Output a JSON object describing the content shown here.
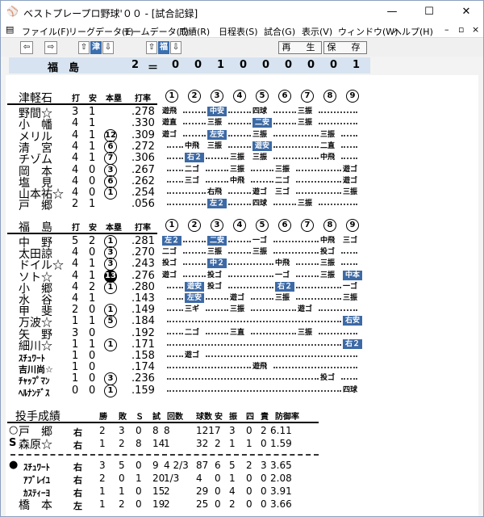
{
  "window": {
    "title": "ベストプレープロ野球'００ - [試合記録]",
    "min": "—",
    "max": "☐",
    "close": "✕"
  },
  "menu": [
    "ファイル(F)",
    "リーグデータ(L)",
    "チームデータ(T)",
    "成績(R)",
    "日程表(S)",
    "試合(G)",
    "表示(V)",
    "ウィンドウ(W)",
    "ヘルプ(H)"
  ],
  "toolbar": {
    "team1": "津",
    "team2": "福",
    "replay": "再　生",
    "save": "保　存"
  },
  "scoreboard": {
    "team": "福　島",
    "runs": "2",
    "eq": "＝",
    "innings": [
      "0",
      "0",
      "1",
      "0",
      "0",
      "0",
      "0",
      "0",
      "1"
    ]
  },
  "tsugaru": {
    "name": "津軽石",
    "cols": {
      "ab": "打",
      "h": "安",
      "hr": "本塁",
      "avg": "打率"
    },
    "innings": [
      "1",
      "2",
      "3",
      "4",
      "5",
      "6",
      "7",
      "8",
      "9"
    ],
    "players": [
      {
        "name": "野間☆",
        "ab": "3",
        "h": "1",
        "hr": "",
        "avg": ".278"
      },
      {
        "name": "小　幡",
        "ab": "4",
        "h": "1",
        "hr": "",
        "avg": ".330"
      },
      {
        "name": "メリル",
        "ab": "4",
        "h": "1",
        "hr": "12",
        "avg": ".309"
      },
      {
        "name": "清　宮",
        "ab": "4",
        "h": "1",
        "hr": "6",
        "avg": ".272"
      },
      {
        "name": "チゾム",
        "ab": "4",
        "h": "1",
        "hr": "7",
        "avg": ".306"
      },
      {
        "name": "岡　本",
        "ab": "4",
        "h": "0",
        "hr": "3",
        "avg": ".267"
      },
      {
        "name": "塩　見",
        "ab": "4",
        "h": "0",
        "hr": "6",
        "avg": ".262"
      },
      {
        "name": "山本祐☆",
        "ab": "4",
        "h": "0",
        "hr": "1",
        "avg": ".254"
      },
      {
        "name": "戸　郷",
        "ab": "2",
        "h": "1",
        "hr": "",
        "avg": ".056"
      }
    ],
    "events": [
      [
        [
          "遊飛",
          0,
          ""
        ],
        [
          "中安",
          2,
          "hit"
        ],
        [
          "四球",
          4,
          ""
        ],
        [
          "三振",
          6,
          ""
        ]
      ],
      [
        [
          "遊直",
          0,
          ""
        ],
        [
          "三振",
          2,
          ""
        ],
        [
          "二安",
          4,
          "hit"
        ],
        [
          "三振",
          6,
          ""
        ]
      ],
      [
        [
          "遊ゴ",
          0,
          ""
        ],
        [
          "左安",
          2,
          "hit"
        ],
        [
          "三振",
          4,
          ""
        ],
        [
          "三振",
          7,
          ""
        ]
      ],
      [
        [
          "中飛",
          1,
          ""
        ],
        [
          "三振",
          2,
          ""
        ],
        [
          "遊安",
          4,
          "hit"
        ],
        [
          "二直",
          7,
          ""
        ]
      ],
      [
        [
          "右２",
          1,
          "hit"
        ],
        [
          "三振",
          3,
          ""
        ],
        [
          "三振",
          4,
          ""
        ],
        [
          "中飛",
          7,
          ""
        ]
      ],
      [
        [
          "二ゴ",
          1,
          ""
        ],
        [
          "三振",
          3,
          ""
        ],
        [
          "三振",
          5,
          ""
        ],
        [
          "遊ゴ",
          8,
          ""
        ]
      ],
      [
        [
          "三ゴ",
          1,
          ""
        ],
        [
          "中飛",
          3,
          ""
        ],
        [
          "二ゴ",
          5,
          ""
        ],
        [
          "遊ゴ",
          8,
          ""
        ]
      ],
      [
        [
          "右飛",
          2,
          ""
        ],
        [
          "遊ゴ",
          4,
          ""
        ],
        [
          "三ゴ",
          5,
          ""
        ],
        [
          "三振",
          8,
          ""
        ]
      ],
      [
        [
          "左２",
          2,
          "hit"
        ],
        [
          "四球",
          4,
          ""
        ],
        [
          "三振",
          6,
          ""
        ]
      ]
    ]
  },
  "fukushima": {
    "name": "福　島",
    "cols": {
      "ab": "打",
      "h": "安",
      "hr": "本塁",
      "avg": "打率"
    },
    "innings": [
      "1",
      "2",
      "3",
      "4",
      "5",
      "6",
      "7",
      "8",
      "9"
    ],
    "players": [
      {
        "name": "中　野",
        "ab": "5",
        "h": "2",
        "hr": "1",
        "avg": ".281",
        "sm": false
      },
      {
        "name": "太田諒",
        "ab": "4",
        "h": "0",
        "hr": "3",
        "avg": ".270",
        "sm": false
      },
      {
        "name": "ドイル☆",
        "ab": "4",
        "h": "1",
        "hr": "3",
        "avg": ".243",
        "sm": false
      },
      {
        "name": "ソト☆",
        "ab": "4",
        "h": "1",
        "hr": "13",
        "avg": ".276",
        "sm": false
      },
      {
        "name": "小　郷",
        "ab": "4",
        "h": "2",
        "hr": "1",
        "avg": ".280",
        "sm": false
      },
      {
        "name": "水　谷",
        "ab": "4",
        "h": "1",
        "hr": "",
        "avg": ".143",
        "sm": false
      },
      {
        "name": "甲　斐",
        "ab": "2",
        "h": "0",
        "hr": "1",
        "avg": ".149",
        "sm": false
      },
      {
        "name": "万波☆",
        "ab": "1",
        "h": "1",
        "hr": "5",
        "avg": ".184",
        "sm": false
      },
      {
        "name": "矢　野",
        "ab": "3",
        "h": "0",
        "hr": "",
        "avg": ".192",
        "sm": false
      },
      {
        "name": "細川☆",
        "ab": "1",
        "h": "1",
        "hr": "1",
        "avg": ".171",
        "sm": false
      },
      {
        "name": "ｽﾁｭﾜｰﾄ",
        "ab": "1",
        "h": "0",
        "hr": "",
        "avg": ".158",
        "sm": true
      },
      {
        "name": "吉川尚☆",
        "ab": "1",
        "h": "0",
        "hr": "",
        "avg": ".174",
        "sm": true
      },
      {
        "name": "ﾁｬｯﾌﾟﾏﾝ",
        "ab": "1",
        "h": "0",
        "hr": "3",
        "avg": ".236",
        "sm": true
      },
      {
        "name": "ﾍﾙﾅﾝﾃﾞｽ",
        "ab": "0",
        "h": "0",
        "hr": "1",
        "avg": ".159",
        "sm": true
      }
    ],
    "events": [
      [
        [
          "左２",
          0,
          "hit"
        ],
        [
          "二安",
          2,
          "hit"
        ],
        [
          "一ゴ",
          4,
          ""
        ],
        [
          "中飛",
          7,
          ""
        ],
        [
          "三ゴ",
          8,
          ""
        ]
      ],
      [
        [
          "二ゴ",
          0,
          ""
        ],
        [
          "三振",
          2,
          ""
        ],
        [
          "三振",
          4,
          ""
        ],
        [
          "投ゴ",
          7,
          ""
        ]
      ],
      [
        [
          "投ゴ",
          0,
          ""
        ],
        [
          "中２",
          2,
          "hit"
        ],
        [
          "中飛",
          5,
          ""
        ],
        [
          "三振",
          7,
          ""
        ]
      ],
      [
        [
          "遊ゴ",
          0,
          ""
        ],
        [
          "投ゴ",
          2,
          ""
        ],
        [
          "一ゴ",
          5,
          ""
        ],
        [
          "三振",
          7,
          ""
        ],
        [
          "中本",
          8,
          "hit"
        ]
      ],
      [
        [
          "遊安",
          1,
          "hit"
        ],
        [
          "投ゴ",
          2,
          ""
        ],
        [
          "右２",
          5,
          "hit"
        ],
        [
          "一ゴ",
          8,
          ""
        ]
      ],
      [
        [
          "左安",
          1,
          "hit"
        ],
        [
          "遊ゴ",
          3,
          ""
        ],
        [
          "三振",
          5,
          ""
        ],
        [
          "三振",
          8,
          ""
        ]
      ],
      [
        [
          "三ギ",
          1,
          ""
        ],
        [
          "三振",
          3,
          ""
        ],
        [
          "遊ゴ",
          6,
          ""
        ]
      ],
      [
        [
          "右安",
          8,
          "hit"
        ]
      ],
      [
        [
          "二ゴ",
          1,
          ""
        ],
        [
          "三直",
          3,
          ""
        ],
        [
          "三振",
          6,
          ""
        ]
      ],
      [
        [
          "右２",
          8,
          "hit"
        ]
      ],
      [
        [
          "遊ゴ",
          1,
          ""
        ]
      ],
      [
        [
          "遊飛",
          4,
          ""
        ]
      ],
      [
        [
          "投ゴ",
          7,
          ""
        ]
      ],
      [
        [
          "四球",
          8,
          ""
        ]
      ]
    ]
  },
  "pitching": {
    "title": "投手成績",
    "cols": [
      "勝",
      "敗",
      "Ｓ",
      "試",
      "回数",
      "球数",
      "安",
      "振",
      "四",
      "責",
      "防御率"
    ],
    "rows": [
      {
        "mark": "○",
        "name": "戸　郷",
        "hand": "右",
        "w": "2",
        "l": "3",
        "s": "0",
        "g": "8",
        "ip": "8",
        "np": "121",
        "h": "7",
        "k": "3",
        "bb": "0",
        "er": "2",
        "era": "6.11",
        "sm": false
      },
      {
        "mark": "S",
        "name": "森原☆",
        "hand": "右",
        "w": "1",
        "l": "2",
        "s": "8",
        "g": "14",
        "ip": "1",
        "np": "32",
        "h": "2",
        "k": "1",
        "bb": "1",
        "er": "0",
        "era": "1.59",
        "sm": false
      },
      {
        "mark": "●",
        "name": "ｽﾁｭﾜｰﾄ",
        "hand": "右",
        "w": "3",
        "l": "5",
        "s": "0",
        "g": "9",
        "ip": "4 2/3",
        "np": "87",
        "h": "6",
        "k": "5",
        "bb": "2",
        "er": "3",
        "era": "3.65",
        "sm": true
      },
      {
        "mark": "",
        "name": "ｱﾌﾞﾚｲﾕ",
        "hand": "右",
        "w": "2",
        "l": "0",
        "s": "1",
        "g": "20",
        "ip": "1/3",
        "np": "4",
        "h": "0",
        "k": "1",
        "bb": "0",
        "er": "0",
        "era": "2.08",
        "sm": true
      },
      {
        "mark": "",
        "name": "ｶｽﾃｨｰﾖ",
        "hand": "右",
        "w": "1",
        "l": "1",
        "s": "0",
        "g": "15",
        "ip": "2",
        "np": "29",
        "h": "0",
        "k": "4",
        "bb": "0",
        "er": "0",
        "era": "3.91",
        "sm": true
      },
      {
        "mark": "",
        "name": "橋　本",
        "hand": "左",
        "w": "1",
        "l": "2",
        "s": "0",
        "g": "19",
        "ip": "2",
        "np": "25",
        "h": "0",
        "k": "2",
        "bb": "0",
        "er": "0",
        "era": "3.66",
        "sm": false
      }
    ]
  }
}
